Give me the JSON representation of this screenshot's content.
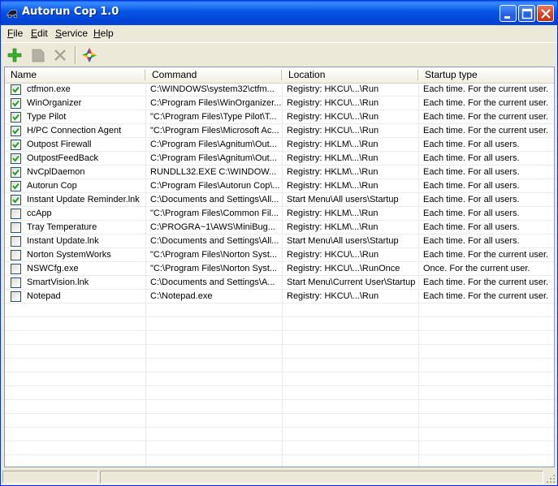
{
  "window": {
    "title": "Autorun Cop 1.0"
  },
  "menu": [
    {
      "label": "File",
      "accel": "F",
      "rest": "ile"
    },
    {
      "label": "Edit",
      "accel": "E",
      "rest": "dit"
    },
    {
      "label": "Service",
      "accel": "S",
      "rest": "ervice"
    },
    {
      "label": "Help",
      "accel": "H",
      "rest": "elp"
    }
  ],
  "toolbar": {
    "items": [
      {
        "name": "add-icon",
        "enabled": true
      },
      {
        "name": "properties-icon",
        "enabled": false
      },
      {
        "name": "delete-icon",
        "enabled": false
      },
      {
        "name": "autorun-cop-logo-icon",
        "enabled": true
      }
    ],
    "colors": {
      "add": "#3bb22f",
      "disabled": "#a7a597"
    }
  },
  "table": {
    "columns": [
      "Name",
      "Command",
      "Location",
      "Startup type"
    ],
    "rows": [
      {
        "checked": true,
        "name": "ctfmon.exe",
        "command": "C:\\WINDOWS\\system32\\ctfm...",
        "location": "Registry: HKCU\\...\\Run",
        "startup": "Each time. For the current user."
      },
      {
        "checked": true,
        "name": "WinOrganizer",
        "command": "C:\\Program Files\\WinOrganizer...",
        "location": "Registry: HKCU\\...\\Run",
        "startup": "Each time. For the current user."
      },
      {
        "checked": true,
        "name": "Type Pilot",
        "command": "\"C:\\Program Files\\Type Pilot\\T...",
        "location": "Registry: HKCU\\...\\Run",
        "startup": "Each time. For the current user."
      },
      {
        "checked": true,
        "name": "H/PC Connection Agent",
        "command": "\"C:\\Program Files\\Microsoft Ac...",
        "location": "Registry: HKCU\\...\\Run",
        "startup": "Each time. For the current user."
      },
      {
        "checked": true,
        "name": "Outpost Firewall",
        "command": "C:\\Program Files\\Agnitum\\Out...",
        "location": "Registry: HKLM\\...\\Run",
        "startup": "Each time. For all users."
      },
      {
        "checked": true,
        "name": "OutpostFeedBack",
        "command": "C:\\Program Files\\Agnitum\\Out...",
        "location": "Registry: HKLM\\...\\Run",
        "startup": "Each time. For all users."
      },
      {
        "checked": true,
        "name": "NvCplDaemon",
        "command": "RUNDLL32.EXE C:\\WINDOW...",
        "location": "Registry: HKLM\\...\\Run",
        "startup": "Each time. For all users."
      },
      {
        "checked": true,
        "name": "Autorun Cop",
        "command": "C:\\Program Files\\Autorun Cop\\...",
        "location": "Registry: HKLM\\...\\Run",
        "startup": "Each time. For all users."
      },
      {
        "checked": true,
        "name": "Instant Update Reminder.lnk",
        "command": "C:\\Documents and Settings\\All...",
        "location": "Start Menu\\All users\\Startup",
        "startup": "Each time. For all users."
      },
      {
        "checked": false,
        "name": "ccApp",
        "command": "\"C:\\Program Files\\Common Fil...",
        "location": "Registry: HKLM\\...\\Run",
        "startup": "Each time. For all users."
      },
      {
        "checked": false,
        "name": "Tray Temperature",
        "command": "C:\\PROGRA~1\\AWS\\MiniBug...",
        "location": "Registry: HKLM\\...\\Run",
        "startup": "Each time. For all users."
      },
      {
        "checked": false,
        "name": "Instant Update.lnk",
        "command": "C:\\Documents and Settings\\All...",
        "location": "Start Menu\\All users\\Startup",
        "startup": "Each time. For all users."
      },
      {
        "checked": false,
        "name": "Norton SystemWorks",
        "command": "\"C:\\Program Files\\Norton Syst...",
        "location": "Registry: HKCU\\...\\Run",
        "startup": "Each time. For the current user."
      },
      {
        "checked": false,
        "name": "NSWCfg.exe",
        "command": "\"C:\\Program Files\\Norton Syst...",
        "location": "Registry: HKCU\\...\\RunOnce",
        "startup": "Once. For the current user."
      },
      {
        "checked": false,
        "name": "SmartVision.lnk",
        "command": "C:\\Documents and Settings\\A...",
        "location": "Start Menu\\Current User\\Startup",
        "startup": "Each time. For the current user."
      },
      {
        "checked": false,
        "name": "Notepad",
        "command": "C:\\Notepad.exe",
        "location": "Registry: HKCU\\...\\Run",
        "startup": "Each time. For the current user."
      }
    ]
  },
  "status": {
    "pane1": "",
    "pane2": ""
  }
}
